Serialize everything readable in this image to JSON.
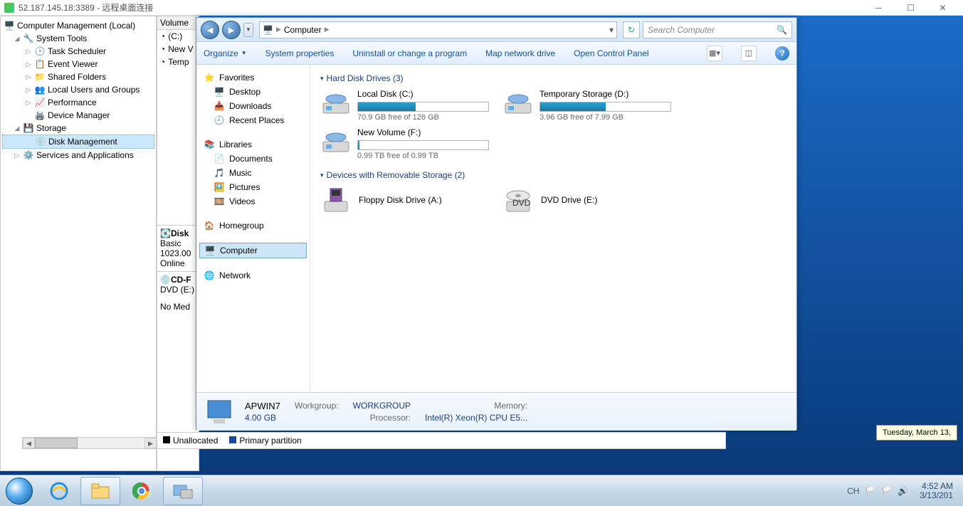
{
  "rdp": {
    "title": "52.187.145.18:3389 - 远程桌面连接"
  },
  "compmgmt": {
    "root": "Computer Management (Local)",
    "systools": "System Tools",
    "items": [
      "Task Scheduler",
      "Event Viewer",
      "Shared Folders",
      "Local Users and Groups",
      "Performance",
      "Device Manager"
    ],
    "storage": "Storage",
    "diskmgmt": "Disk Management",
    "services": "Services and Applications"
  },
  "dm": {
    "hdr": "Volume",
    "rows": [
      "(C:)",
      "New V",
      "Temp"
    ],
    "disk_lbl": "Disk",
    "disk_basic": "Basic",
    "disk_size": "1023.00",
    "disk_status": "Online",
    "cd_lbl": "CD-F",
    "cd_dvd": "DVD (E:)",
    "cd_media": "No Med"
  },
  "explorer": {
    "breadcrumb": [
      "Computer"
    ],
    "search_placeholder": "Search Computer",
    "toolbar": {
      "organize": "Organize",
      "sysprops": "System properties",
      "uninstall": "Uninstall or change a program",
      "mapdrive": "Map network drive",
      "controlpanel": "Open Control Panel"
    },
    "nav": {
      "favorites": "Favorites",
      "fav_items": [
        "Desktop",
        "Downloads",
        "Recent Places"
      ],
      "libraries": "Libraries",
      "lib_items": [
        "Documents",
        "Music",
        "Pictures",
        "Videos"
      ],
      "homegroup": "Homegroup",
      "computer": "Computer",
      "network": "Network"
    },
    "groups": {
      "hdd": "Hard Disk Drives (3)",
      "removable": "Devices with Removable Storage (2)"
    },
    "drives": [
      {
        "name": "Local Disk (C:)",
        "free": "70.9 GB free of 126 GB",
        "pct": 44
      },
      {
        "name": "Temporary Storage (D:)",
        "free": "3.96 GB free of 7.99 GB",
        "pct": 50
      },
      {
        "name": "New Volume (F:)",
        "free": "0.99 TB free of 0.99 TB",
        "pct": 1
      }
    ],
    "devices": [
      {
        "name": "Floppy Disk Drive (A:)"
      },
      {
        "name": "DVD Drive (E:)"
      }
    ],
    "details": {
      "name": "APWIN7",
      "workgroup_lbl": "Workgroup:",
      "workgroup": "WORKGROUP",
      "memory_lbl": "Memory:",
      "memory": "4.00 GB",
      "processor_lbl": "Processor:",
      "processor": "Intel(R) Xeon(R) CPU E5..."
    }
  },
  "legend": {
    "unalloc": "Unallocated",
    "primary": "Primary partition"
  },
  "taskbar": {
    "lang": "CH",
    "time": "4:52 AM",
    "date": "3/13/201",
    "tooltip": "Tuesday, March 13,"
  }
}
